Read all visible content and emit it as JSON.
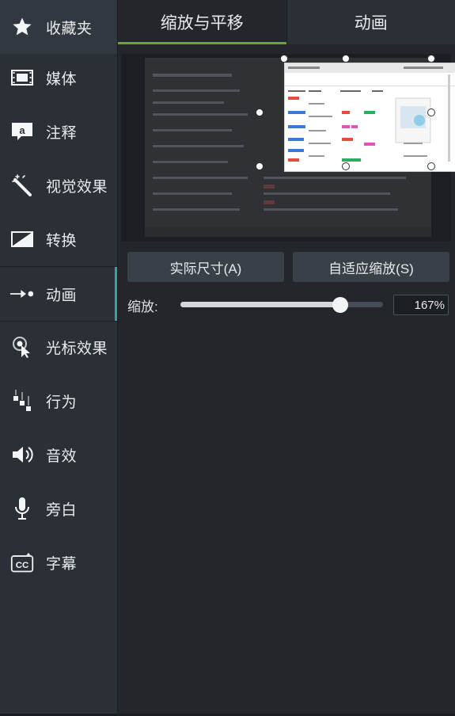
{
  "sidebar": {
    "items": [
      {
        "label": "收藏夹",
        "icon": "star-icon"
      },
      {
        "label": "媒体",
        "icon": "film-icon"
      },
      {
        "label": "注释",
        "icon": "annotation-icon"
      },
      {
        "label": "视觉效果",
        "icon": "magic-wand-icon"
      },
      {
        "label": "转换",
        "icon": "transition-icon"
      },
      {
        "label": "动画",
        "icon": "animation-arrow-icon"
      },
      {
        "label": "光标效果",
        "icon": "cursor-effect-icon"
      },
      {
        "label": "行为",
        "icon": "behavior-icon"
      },
      {
        "label": "音效",
        "icon": "speaker-icon"
      },
      {
        "label": "旁白",
        "icon": "microphone-icon"
      },
      {
        "label": "字幕",
        "icon": "captions-icon"
      }
    ]
  },
  "tabs": [
    {
      "label": "缩放与平移"
    },
    {
      "label": "动画"
    }
  ],
  "buttons": {
    "actual_size": "实际尺寸(A)",
    "fit_zoom": "自适应缩放(S)"
  },
  "zoom": {
    "label": "缩放:",
    "value": "167%",
    "slider_fraction": 0.79
  },
  "colors": {
    "accent_green": "#6aa81f",
    "accent_teal": "#2fa89a"
  }
}
